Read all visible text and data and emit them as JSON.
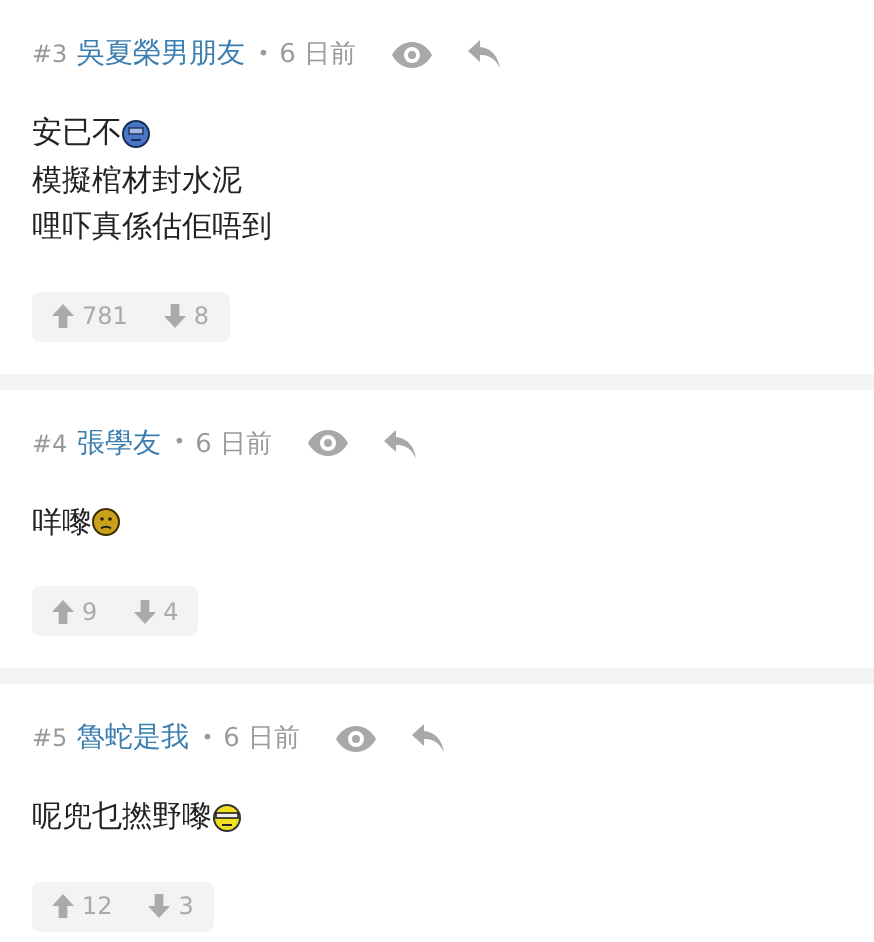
{
  "posts": [
    {
      "number": "#3",
      "author": "吳夏榮男朋友",
      "separator": "•",
      "time": "6 日前",
      "lines": [
        {
          "text": "安已不",
          "kind": "dizzy"
        },
        {
          "text": "模擬棺材封水泥"
        },
        {
          "text": "哩吓真係估佢唔到"
        }
      ],
      "upvotes": "781",
      "downvotes": "8"
    },
    {
      "number": "#4",
      "author": "張學友",
      "separator": "•",
      "time": "6 日前",
      "lines": [
        {
          "text": "咩嚟",
          "kind": "frown"
        }
      ],
      "upvotes": "9",
      "downvotes": "4"
    },
    {
      "number": "#5",
      "author": "魯蛇是我",
      "separator": "•",
      "time": "6 日前",
      "lines": [
        {
          "text": "呢兜乜撚野嚟",
          "kind": "shades"
        }
      ],
      "upvotes": "12",
      "downvotes": "3"
    }
  ]
}
